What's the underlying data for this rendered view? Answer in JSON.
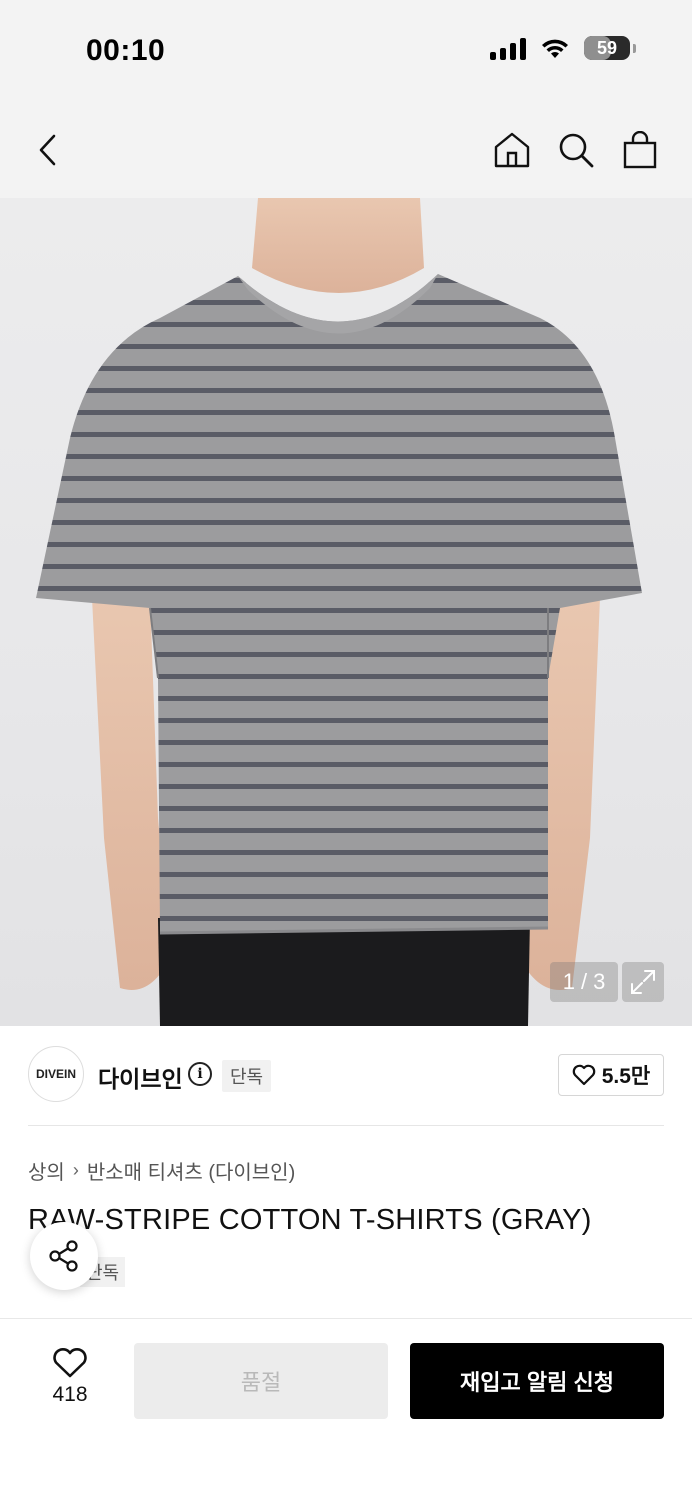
{
  "status_bar": {
    "time": "00:10",
    "battery": "59"
  },
  "nav": {
    "back_icon": "chevron-left-icon",
    "home_icon": "home-icon",
    "search_icon": "search-icon",
    "cart_icon": "shopping-bag-icon"
  },
  "gallery": {
    "current": "1",
    "separator": "/",
    "total": "3",
    "expand_icon": "expand-icon"
  },
  "brand": {
    "logo_text": "DIVEIN",
    "name": "다이브인",
    "badge": "단독",
    "likes": "5.5만"
  },
  "breadcrumb": {
    "category": "상의",
    "subcategory": "반소매 티셔츠 (다이브인)"
  },
  "product": {
    "title": "RAW-STRIPE COTTON T-SHIRTS (GRAY)",
    "badge": "단독"
  },
  "bottom_bar": {
    "wish_count": "418",
    "soldout_label": "품절",
    "restock_label": "재입고 알림 신청"
  },
  "colors": {
    "accent": "#000000",
    "nav_bg": "#f3f3f3"
  }
}
